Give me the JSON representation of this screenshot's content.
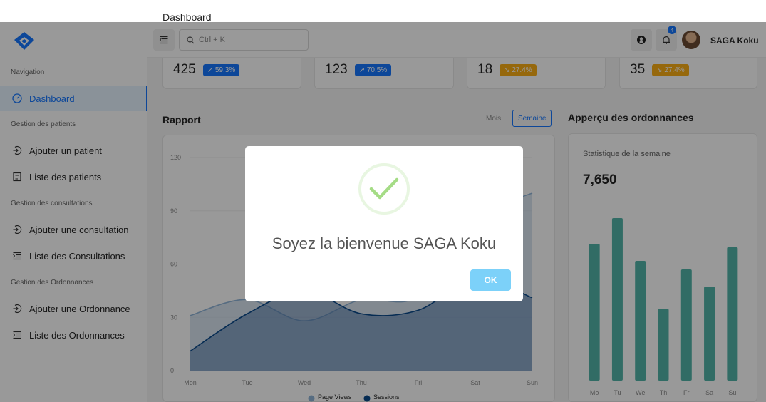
{
  "window": {
    "title": "Dashboard"
  },
  "sidebar": {
    "sections": [
      {
        "label": "Navigation"
      },
      {
        "label": "Gestion des patients"
      },
      {
        "label": "Gestion des consultations"
      },
      {
        "label": "Gestion des Ordonnances"
      }
    ],
    "items": [
      {
        "label": "Dashboard",
        "icon": "dashboard-icon",
        "active": true
      },
      {
        "label": "Ajouter un patient",
        "icon": "login-icon"
      },
      {
        "label": "Liste des patients",
        "icon": "file-text-icon"
      },
      {
        "label": "Ajouter une consultation",
        "icon": "login-icon"
      },
      {
        "label": "Liste des Consultations",
        "icon": "list-indent-icon"
      },
      {
        "label": "Ajouter une Ordonnance",
        "icon": "login-icon"
      },
      {
        "label": "Liste des Ordonnances",
        "icon": "list-indent-icon"
      }
    ]
  },
  "header": {
    "search_placeholder": "Ctrl + K",
    "notification_count": "4",
    "user_name": "SAGA Koku",
    "icons": [
      "menu-fold-icon",
      "search-icon",
      "github-icon",
      "bell-icon"
    ]
  },
  "stats": [
    {
      "value": "425",
      "pct": "59.3%",
      "trend": "up"
    },
    {
      "value": "123",
      "pct": "70.5%",
      "trend": "up"
    },
    {
      "value": "18",
      "pct": "27.4%",
      "trend": "down"
    },
    {
      "value": "35",
      "pct": "27.4%",
      "trend": "down"
    }
  ],
  "report": {
    "title": "Rapport",
    "toggles": {
      "month": "Mois",
      "week": "Semaine",
      "selected": "Semaine"
    }
  },
  "prescriptions": {
    "title": "Apperçu des ordonnances",
    "subtitle": "Statistique de la semaine",
    "total": "7,650"
  },
  "modal": {
    "message": "Soyez la bienvenue SAGA Koku",
    "ok_label": "OK",
    "icon": "success-check-icon"
  },
  "colors": {
    "primary": "#1677ff",
    "warning": "#faad14",
    "teal": "#52b5a8",
    "check": "#a5dc86",
    "ok_button": "#7cd1f9"
  },
  "chart_data": [
    {
      "type": "area",
      "categories": [
        "Mon",
        "Tue",
        "Wed",
        "Thu",
        "Fri",
        "Sat",
        "Sun"
      ],
      "ylim": [
        0,
        120
      ],
      "yticks": [
        0,
        30,
        60,
        90,
        120
      ],
      "series": [
        {
          "name": "Page Views",
          "values": [
            31,
            40,
            28,
            40,
            42,
            85,
            100
          ],
          "color": "#90b4d8"
        },
        {
          "name": "Sessions",
          "values": [
            11,
            32,
            45,
            32,
            34,
            52,
            41
          ],
          "color": "#0b4a8b"
        }
      ],
      "legend": "bottom"
    },
    {
      "type": "bar",
      "categories": [
        "Mo",
        "Tu",
        "We",
        "Th",
        "Fr",
        "Sa",
        "Su"
      ],
      "values": [
        80,
        95,
        70,
        42,
        65,
        55,
        78
      ],
      "color": "#52b5a8"
    }
  ]
}
